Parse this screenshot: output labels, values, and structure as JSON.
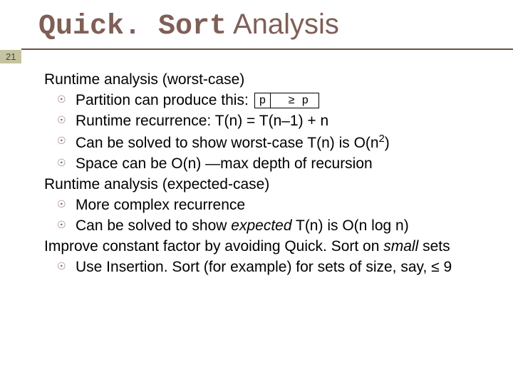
{
  "slide": {
    "page_number": "21",
    "title_code": "Quick. Sort",
    "title_rest": " Analysis",
    "section1_header": "Runtime analysis (worst-case)",
    "section1_items": {
      "b1_pre": "Partition can produce this: ",
      "b1_cell_p": "p",
      "b1_cell_rest": "≥ p",
      "b2": "Runtime recurrence:  T(n) = T(n–1) + n",
      "b3_pre": "Can be solved to show worst-case T(n) is O(n",
      "b3_sup": "2",
      "b3_post": ")",
      "b4": "Space can be O(n) —max depth of recursion"
    },
    "section2_header": "Runtime analysis (expected-case)",
    "section2_items": {
      "b1": "More complex recurrence",
      "b2_pre": "Can be solved to show ",
      "b2_em": "expected",
      "b2_post": " T(n) is O(n log n)"
    },
    "section3_header_pre": "Improve constant factor by avoiding Quick. Sort on ",
    "section3_header_em": "small",
    "section3_header_post": " sets",
    "section3_items": {
      "b1": "Use Insertion. Sort (for example) for sets of size, say, ≤ 9"
    }
  }
}
